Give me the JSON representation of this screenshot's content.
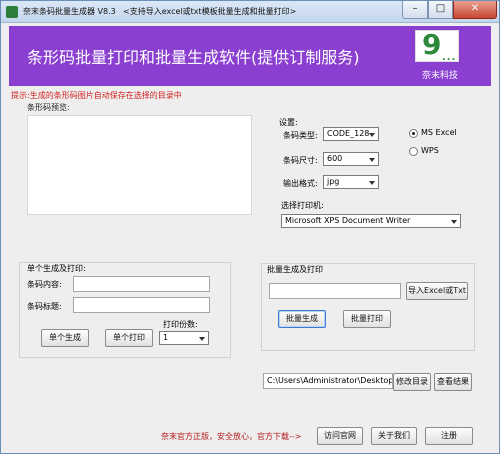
{
  "window": {
    "title": "奈末条码批量生成器 V8.3",
    "hint": "<支持导入excel或txt模板批量生成和批量打印>",
    "min_glyph": "–",
    "max_glyph": "□",
    "close_glyph": "✕"
  },
  "banner": {
    "title": "条形码批量打印和批量生成软件(提供订制服务)",
    "logo_mark": "9",
    "logo_dots": "...",
    "logo_text": "奈末科技",
    "bg_color": "#8a3fd0"
  },
  "notice": "提示:生成的条形码图片自动保存在选择的目录中",
  "preview": {
    "label": "条形码预览:"
  },
  "settings": {
    "label": "设置:",
    "barcode_type_label": "条码类型:",
    "barcode_type_value": "CODE_128",
    "size_label": "条码尺寸:",
    "size_value": "600",
    "format_label": "输出格式:",
    "format_value": "jpg",
    "output_options": [
      {
        "label": "MS  Excel",
        "selected": true
      },
      {
        "label": "WPS",
        "selected": false
      }
    ],
    "printer_label": "选择打印机:",
    "printer_value": "Microsoft XPS Document Writer"
  },
  "single": {
    "label": "单个生成及打印:",
    "content_label": "条码内容:",
    "content_value": "",
    "title_label": "条码标题:",
    "title_value": "",
    "copies_label": "打印份数:",
    "copies_value": "1",
    "generate_button": "单个生成",
    "print_button": "单个打印"
  },
  "batch": {
    "label": "批量生成及打印",
    "file_value": "",
    "import_button": "导入Excel或Txt",
    "generate_button": "批量生成",
    "print_button": "批量打印"
  },
  "output_dir": {
    "path": "C:\\Users\\Administrator\\Desktop",
    "change_button": "修改目录",
    "view_button": "查看结果"
  },
  "footer": {
    "promo": "奈末官方正版，安全放心，官方下载-->",
    "visit_button": "访问官网",
    "about_button": "关于我们",
    "register_button": "注册"
  }
}
